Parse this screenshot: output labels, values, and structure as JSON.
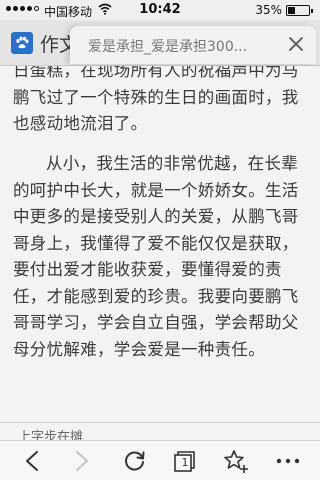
{
  "status_bar": {
    "carrier": "中国移动",
    "time": "10:42",
    "battery_percent": "35%",
    "battery_level": 0.35
  },
  "browser": {
    "site_title": "作文",
    "tab_title": "爱是承担_爱是承担300...",
    "tab_count": "1"
  },
  "article": {
    "paragraph_1": "日蛋糕，在现场所有人的祝福声中为马鹏飞过了一个特殊的生日的画面时，我也感动地流泪了。",
    "paragraph_2": "从小，我生活的非常优越，在长辈的呵护中长大，就是一个娇娇女。生活中更多的是接受别人的关爱，从鹏飞哥哥身上，我懂得了爱不能仅仅是获取，要付出爱才能收获爱，要懂得爱的责任，才能感到爱的珍贵。我要向要鹏飞哥哥学习，学会自立自强，学会帮助父母分忧解难，学会爱是一种责任。",
    "next_snippet": "上字步在摊"
  },
  "icons": [
    "baidu-paw-icon",
    "wifi-icon",
    "close-icon",
    "back-icon",
    "forward-icon",
    "reload-icon",
    "tabs-icon",
    "bookmark-add-icon",
    "more-icon"
  ]
}
